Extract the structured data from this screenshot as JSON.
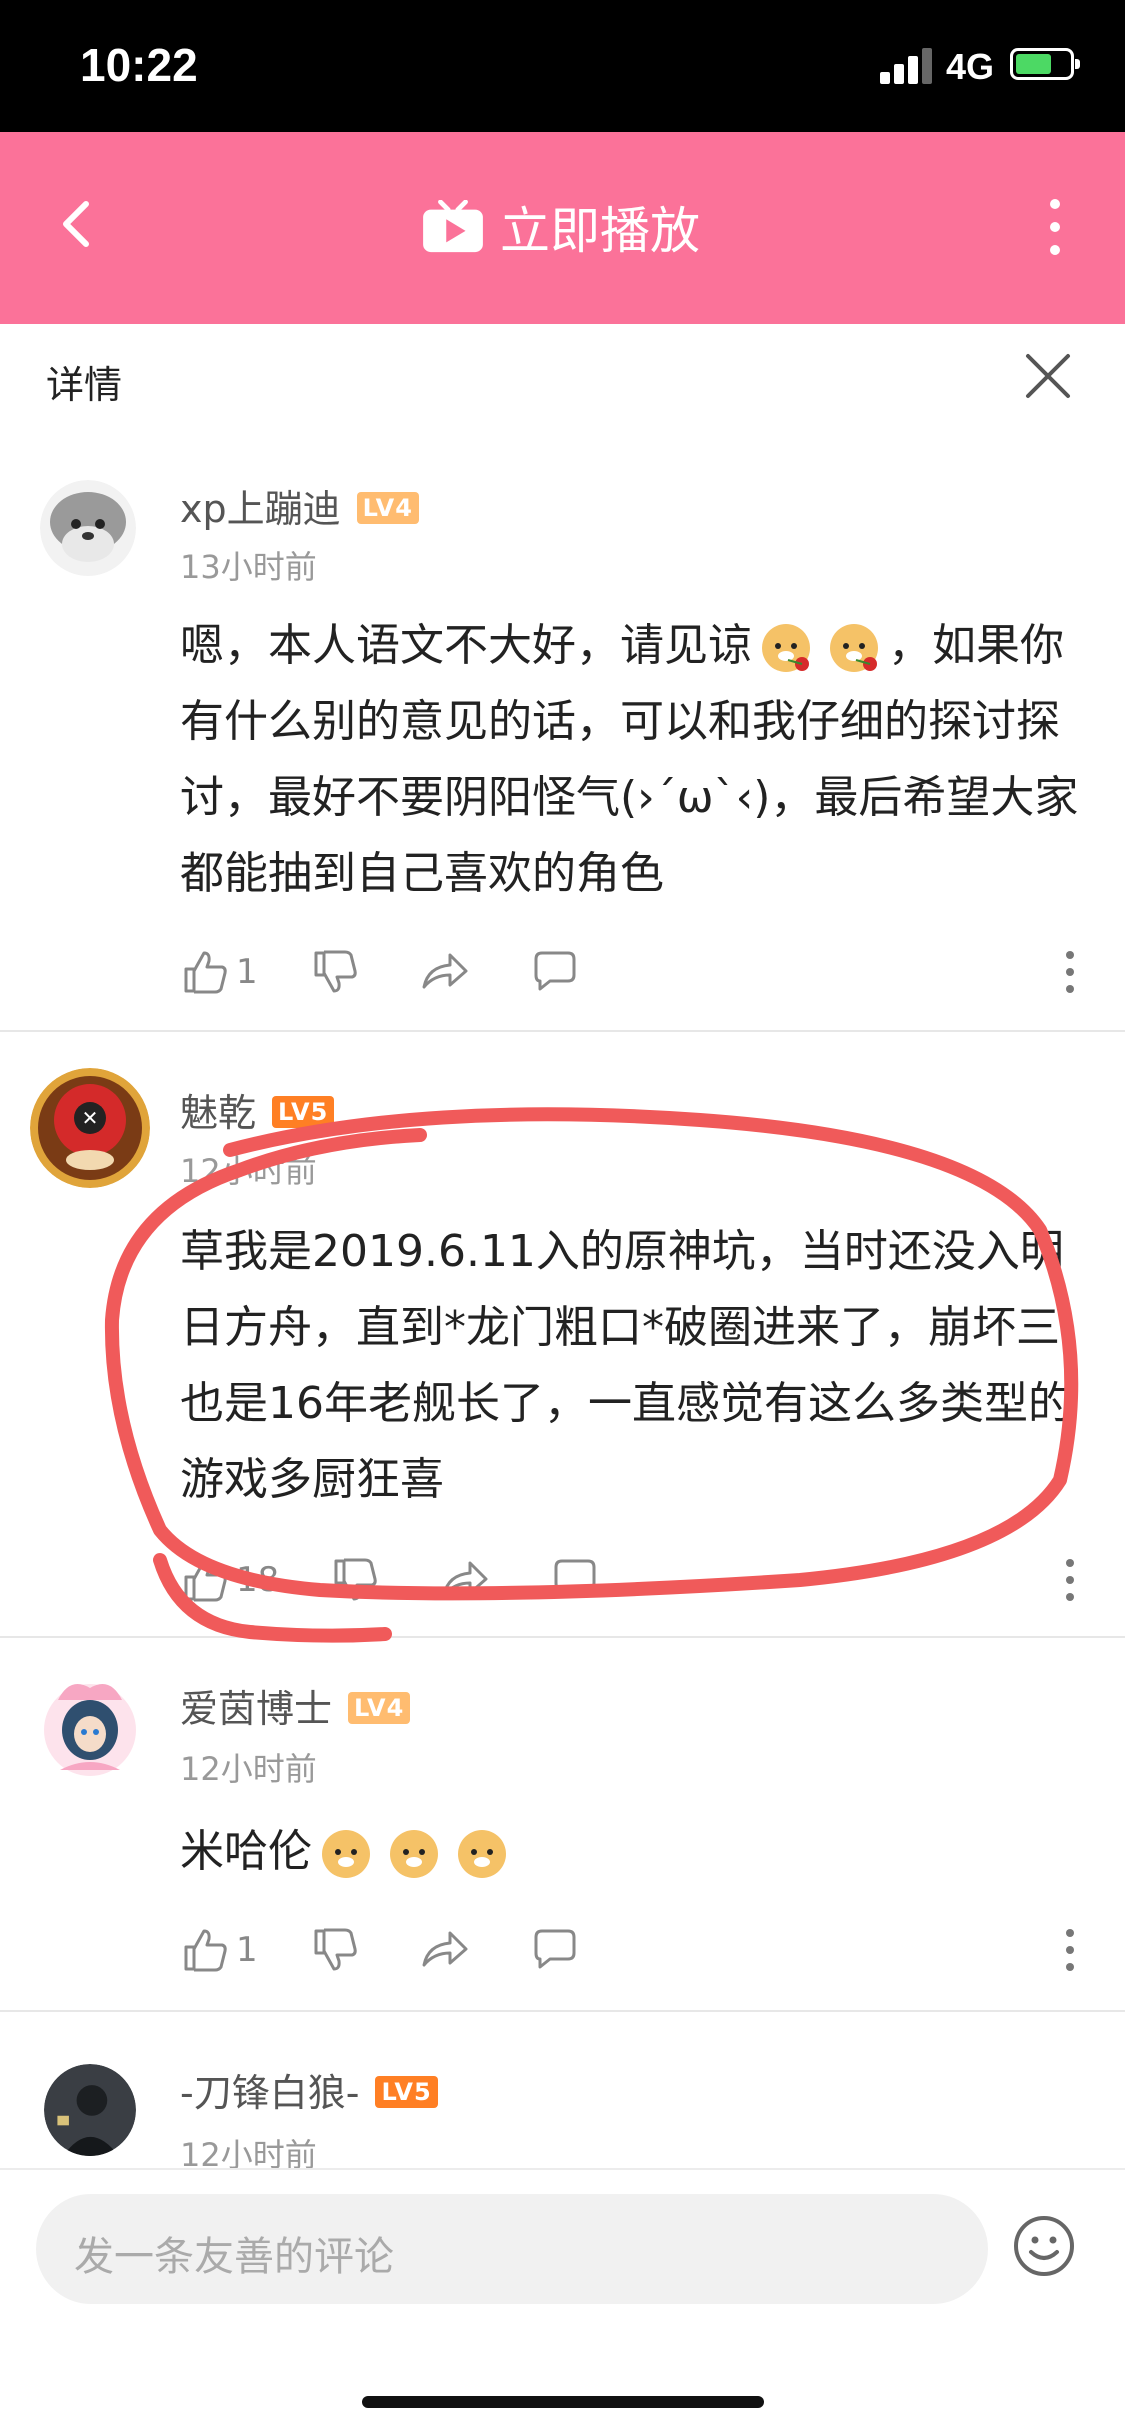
{
  "status_bar": {
    "time": "10:22",
    "network": "4G"
  },
  "top_bar": {
    "play_label": "立即播放"
  },
  "detail_header": {
    "label": "详情"
  },
  "comments": [
    {
      "username": "xp上蹦迪",
      "level": "LV4",
      "time": "13小时前",
      "text_parts": [
        "嗯，本人语文不大好，请见谅",
        "，如果你有什么别的意见的话，可以和我仔细的探讨探讨，最好不要阴阳怪气(›´ω`‹)，最后希望大家都能抽到自己喜欢的角色"
      ],
      "likes": "1"
    },
    {
      "username": "魅乾",
      "level": "LV5",
      "time": "12小时前",
      "text": "草我是2019.6.11入的原神坑，当时还没入明日方舟，直到*龙门粗口*破圈进来了，崩坏三也是16年老舰长了，一直感觉有这么多类型的游戏多厨狂喜",
      "likes": "18"
    },
    {
      "username": "爱茵博士",
      "level": "LV4",
      "time": "12小时前",
      "text": "米哈伦",
      "likes": "1"
    },
    {
      "username": "-刀锋白狼-",
      "level": "LV5",
      "time": "12小时前"
    }
  ],
  "input_bar": {
    "placeholder": "发一条友善的评论"
  },
  "colors": {
    "brand_pink": "#fb7299",
    "annotation_red": "#f05a5a"
  }
}
